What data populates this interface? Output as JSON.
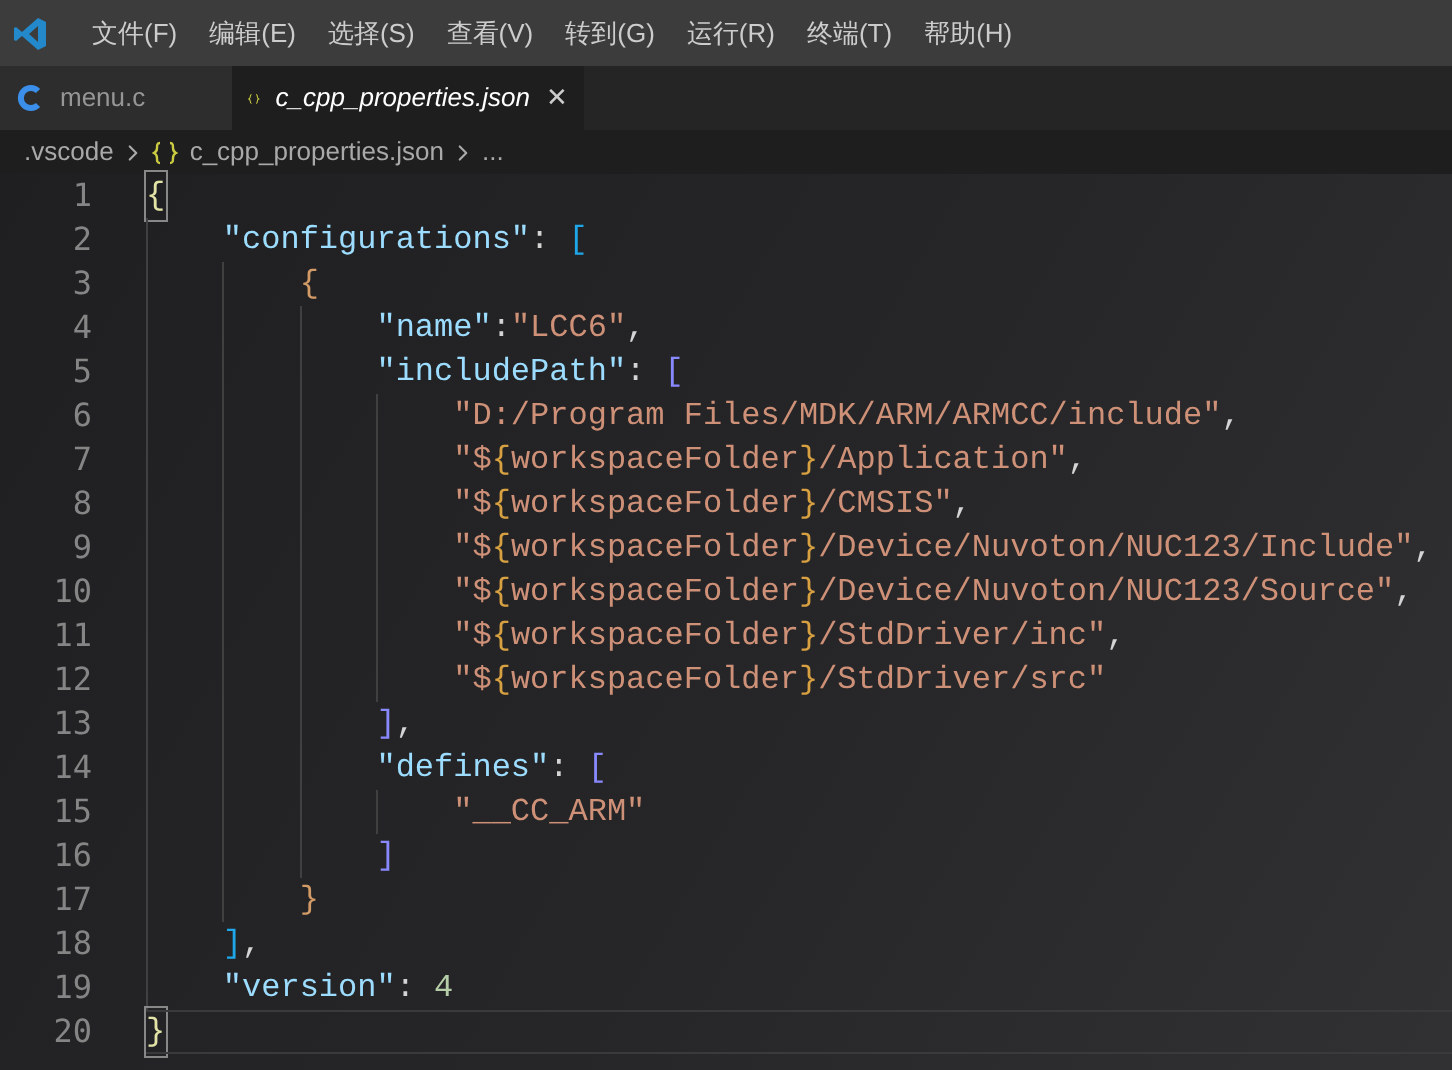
{
  "menu_bar": {
    "items": [
      "文件(F)",
      "编辑(E)",
      "选择(S)",
      "查看(V)",
      "转到(G)",
      "运行(R)",
      "终端(T)",
      "帮助(H)"
    ]
  },
  "tabs": [
    {
      "label": "menu.c",
      "kind": "c",
      "selected": false,
      "italic": false
    },
    {
      "label": "c_cpp_properties.json",
      "kind": "json",
      "selected": true,
      "italic": true,
      "close": "✕"
    }
  ],
  "breadcrumb": {
    "folder": ".vscode",
    "file": "c_cpp_properties.json",
    "tail": "..."
  },
  "editor": {
    "lines": [
      {
        "number": "1",
        "current": false,
        "tokens": [
          {
            "text": "{",
            "kind": "bracket1",
            "boxed": true
          }
        ]
      },
      {
        "number": "2",
        "current": false,
        "tokens": [
          {
            "text": "    \"configurations\"",
            "kind": "key"
          },
          {
            "text": ": ",
            "kind": "punct"
          },
          {
            "text": "[",
            "kind": "bracket2"
          }
        ]
      },
      {
        "number": "3",
        "current": false,
        "tokens": [
          {
            "text": "        {",
            "kind": "bracket3"
          }
        ]
      },
      {
        "number": "4",
        "current": false,
        "tokens": [
          {
            "text": "            \"name\"",
            "kind": "key"
          },
          {
            "text": ":",
            "kind": "punct"
          },
          {
            "text": "\"LCC6\"",
            "kind": "string"
          },
          {
            "text": ",",
            "kind": "punct"
          }
        ]
      },
      {
        "number": "5",
        "current": false,
        "tokens": [
          {
            "text": "            \"includePath\"",
            "kind": "key"
          },
          {
            "text": ": ",
            "kind": "punct"
          },
          {
            "text": "[",
            "kind": "bracket4"
          }
        ]
      },
      {
        "number": "6",
        "current": false,
        "tokens": [
          {
            "text": "                \"D:/Program Files/MDK/ARM/ARMCC/include\"",
            "kind": "string"
          },
          {
            "text": ",",
            "kind": "punct"
          }
        ]
      },
      {
        "number": "7",
        "current": false,
        "tokens": [
          {
            "text": "                \"$",
            "kind": "string"
          },
          {
            "text": "{",
            "kind": "interp"
          },
          {
            "text": "workspaceFolder",
            "kind": "string"
          },
          {
            "text": "}",
            "kind": "interp"
          },
          {
            "text": "/Application\"",
            "kind": "string"
          },
          {
            "text": ",",
            "kind": "punct"
          }
        ]
      },
      {
        "number": "8",
        "current": false,
        "tokens": [
          {
            "text": "                \"$",
            "kind": "string"
          },
          {
            "text": "{",
            "kind": "interp"
          },
          {
            "text": "workspaceFolder",
            "kind": "string"
          },
          {
            "text": "}",
            "kind": "interp"
          },
          {
            "text": "/CMSIS\"",
            "kind": "string"
          },
          {
            "text": ",",
            "kind": "punct"
          }
        ]
      },
      {
        "number": "9",
        "current": false,
        "tokens": [
          {
            "text": "                \"$",
            "kind": "string"
          },
          {
            "text": "{",
            "kind": "interp"
          },
          {
            "text": "workspaceFolder",
            "kind": "string"
          },
          {
            "text": "}",
            "kind": "interp"
          },
          {
            "text": "/Device/Nuvoton/NUC123/Include\"",
            "kind": "string"
          },
          {
            "text": ",",
            "kind": "punct"
          }
        ]
      },
      {
        "number": "10",
        "current": false,
        "tokens": [
          {
            "text": "                \"$",
            "kind": "string"
          },
          {
            "text": "{",
            "kind": "interp"
          },
          {
            "text": "workspaceFolder",
            "kind": "string"
          },
          {
            "text": "}",
            "kind": "interp"
          },
          {
            "text": "/Device/Nuvoton/NUC123/Source\"",
            "kind": "string"
          },
          {
            "text": ",",
            "kind": "punct"
          }
        ]
      },
      {
        "number": "11",
        "current": false,
        "tokens": [
          {
            "text": "                \"$",
            "kind": "string"
          },
          {
            "text": "{",
            "kind": "interp"
          },
          {
            "text": "workspaceFolder",
            "kind": "string"
          },
          {
            "text": "}",
            "kind": "interp"
          },
          {
            "text": "/StdDriver/inc\"",
            "kind": "string"
          },
          {
            "text": ",",
            "kind": "punct"
          }
        ]
      },
      {
        "number": "12",
        "current": false,
        "tokens": [
          {
            "text": "                \"$",
            "kind": "string"
          },
          {
            "text": "{",
            "kind": "interp"
          },
          {
            "text": "workspaceFolder",
            "kind": "string"
          },
          {
            "text": "}",
            "kind": "interp"
          },
          {
            "text": "/StdDriver/src\"",
            "kind": "string"
          }
        ]
      },
      {
        "number": "13",
        "current": false,
        "tokens": [
          {
            "text": "            ]",
            "kind": "bracket4"
          },
          {
            "text": ",",
            "kind": "punct"
          }
        ]
      },
      {
        "number": "14",
        "current": false,
        "tokens": [
          {
            "text": "            \"defines\"",
            "kind": "key"
          },
          {
            "text": ": ",
            "kind": "punct"
          },
          {
            "text": "[",
            "kind": "bracket4"
          }
        ]
      },
      {
        "number": "15",
        "current": false,
        "tokens": [
          {
            "text": "                \"__CC_ARM\"",
            "kind": "string"
          }
        ]
      },
      {
        "number": "16",
        "current": false,
        "tokens": [
          {
            "text": "            ]",
            "kind": "bracket4"
          }
        ]
      },
      {
        "number": "17",
        "current": false,
        "tokens": [
          {
            "text": "        }",
            "kind": "bracket3"
          }
        ]
      },
      {
        "number": "18",
        "current": false,
        "tokens": [
          {
            "text": "    ]",
            "kind": "bracket2"
          },
          {
            "text": ",",
            "kind": "punct"
          }
        ]
      },
      {
        "number": "19",
        "current": false,
        "tokens": [
          {
            "text": "    \"version\"",
            "kind": "key"
          },
          {
            "text": ": ",
            "kind": "punct"
          },
          {
            "text": "4",
            "kind": "number"
          }
        ]
      },
      {
        "number": "20",
        "current": true,
        "tokens": [
          {
            "text": "}",
            "kind": "bracket1",
            "boxed": true
          }
        ]
      }
    ]
  }
}
